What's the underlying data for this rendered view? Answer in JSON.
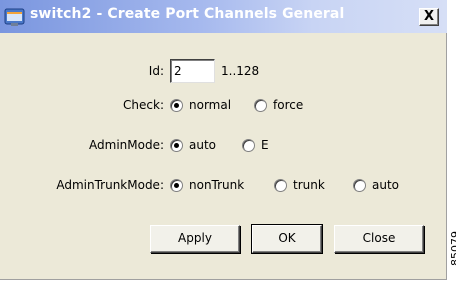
{
  "window": {
    "title": "switch2 - Create Port Channels General",
    "close_label": "X",
    "icon": "app-window-icon"
  },
  "form": {
    "id": {
      "label": "Id:",
      "value": "2",
      "range": "1..128"
    },
    "check": {
      "label": "Check:",
      "options": [
        "normal",
        "force"
      ],
      "selected": "normal"
    },
    "admin_mode": {
      "label": "AdminMode:",
      "options": [
        "auto",
        "E"
      ],
      "selected": "auto"
    },
    "admin_trunk_mode": {
      "label": "AdminTrunkMode:",
      "options": [
        "nonTrunk",
        "trunk",
        "auto"
      ],
      "selected": "nonTrunk"
    }
  },
  "buttons": {
    "apply": "Apply",
    "ok": "OK",
    "close": "Close"
  },
  "figure_code": "85079",
  "colors": {
    "dialog_bg": "#ece9d8",
    "title_gradient_start": "#7a96df",
    "title_text": "#ffffff"
  }
}
